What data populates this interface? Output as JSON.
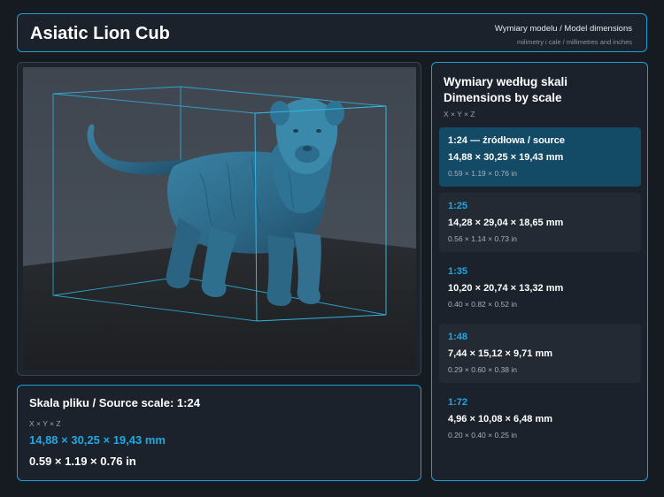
{
  "header": {
    "title": "Asiatic Lion Cub",
    "subtitle": "Wymiary modelu / Model dimensions",
    "units_note": "milimetry i cale / millimetres and inches"
  },
  "source": {
    "title": "Skala pliku / Source scale: 1:24",
    "axes": "X × Y × Z",
    "mm": "14,88 × 30,25 × 19,43 mm",
    "inches": "0.59 × 1.19 × 0.76 in"
  },
  "scales": {
    "title": "Wymiary według skali Dimensions by scale",
    "axes": "X × Y × Z",
    "items": [
      {
        "label": "1:24  —  źródłowa / source",
        "mm": "14,88 × 30,25 × 19,43 mm",
        "inches": "0.59 × 1.19 × 0.76 in",
        "active": true
      },
      {
        "label": "1:25",
        "mm": "14,28 × 29,04 × 18,65 mm",
        "inches": "0.56 × 1.14 × 0.73 in",
        "active": false
      },
      {
        "label": "1:35",
        "mm": "10,20 × 20,74 × 13,32 mm",
        "inches": "0.40 × 0.82 × 0.52 in",
        "active": false
      },
      {
        "label": "1:48",
        "mm": "7,44 × 15,12 × 9,71 mm",
        "inches": "0.29 × 0.60 × 0.38 in",
        "active": false
      },
      {
        "label": "1:72",
        "mm": "4,96 × 10,08 × 6,48 mm",
        "inches": "0.20 × 0.40 × 0.25 in",
        "active": false
      }
    ]
  },
  "colors": {
    "accent": "#1ea8e3",
    "model": "#2f6f8e",
    "active_card": "#134a66"
  }
}
